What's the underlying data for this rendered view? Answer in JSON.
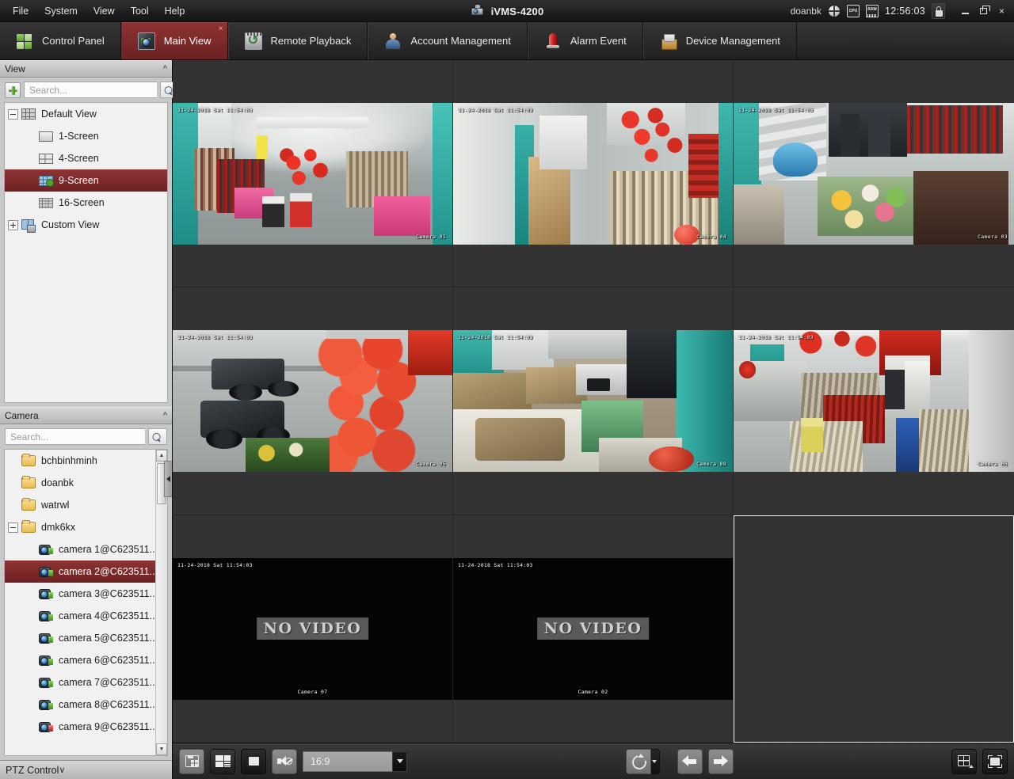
{
  "window": {
    "app_title": "iVMS-4200",
    "app_icon": "camera-logo-icon",
    "menu": [
      {
        "label": "File"
      },
      {
        "label": "System"
      },
      {
        "label": "View"
      },
      {
        "label": "Tool"
      },
      {
        "label": "Help"
      }
    ],
    "user": "doanbk",
    "status_icons": [
      "globe-icon",
      "cpu-icon",
      "ram-icon"
    ],
    "cpu_label": "CPU",
    "ram_label": "RAM",
    "clock": "12:56:03",
    "lock_icon": "lock-icon",
    "controls": {
      "minimize": "–",
      "restore": "restore",
      "close": "×"
    }
  },
  "tabs": [
    {
      "label": "Control Panel",
      "icon": "control-panel-icon",
      "active": false,
      "closable": false
    },
    {
      "label": "Main View",
      "icon": "main-view-icon",
      "active": true,
      "closable": true,
      "close_glyph": "×"
    },
    {
      "label": "Remote Playback",
      "icon": "remote-playback-icon",
      "active": false,
      "closable": false
    },
    {
      "label": "Account Management",
      "icon": "account-management-icon",
      "active": false,
      "closable": false
    },
    {
      "label": "Alarm Event",
      "icon": "alarm-event-icon",
      "active": false,
      "closable": false
    },
    {
      "label": "Device Management",
      "icon": "device-management-icon",
      "active": false,
      "closable": false
    }
  ],
  "sidebar": {
    "view_panel": {
      "title": "View",
      "collapse_glyph": "▲",
      "add_button": "add-view-button",
      "search_placeholder": "Search...",
      "search_value": "",
      "tree": [
        {
          "label": "Default View",
          "icon": "grid-view-icon",
          "level": 0,
          "expander": "minus",
          "selected": false
        },
        {
          "label": "1-Screen",
          "icon": "one-screen-icon",
          "level": 1,
          "expander": "none",
          "selected": false
        },
        {
          "label": "4-Screen",
          "icon": "four-screen-icon",
          "level": 1,
          "expander": "none",
          "selected": false
        },
        {
          "label": "9-Screen",
          "icon": "nine-screen-icon",
          "level": 1,
          "expander": "none",
          "selected": true
        },
        {
          "label": "16-Screen",
          "icon": "sixteen-screen-icon",
          "level": 1,
          "expander": "none",
          "selected": false
        },
        {
          "label": "Custom View",
          "icon": "custom-view-icon",
          "level": 0,
          "expander": "plus",
          "selected": false
        }
      ]
    },
    "camera_panel": {
      "title": "Camera",
      "collapse_glyph": "▲",
      "search_placeholder": "Search...",
      "search_value": "",
      "tree": [
        {
          "label": "bchbinhminh",
          "icon": "folder-icon",
          "level": 0,
          "expander": "none",
          "selected": false
        },
        {
          "label": "doanbk",
          "icon": "folder-icon",
          "level": 0,
          "expander": "none",
          "selected": false
        },
        {
          "label": "watrwl",
          "icon": "folder-icon",
          "level": 0,
          "expander": "none",
          "selected": false
        },
        {
          "label": "dmk6kx",
          "icon": "folder-icon",
          "level": 0,
          "expander": "minus",
          "selected": false
        },
        {
          "label": "camera 1@C623511...",
          "icon": "camera-online-icon",
          "level": 1,
          "expander": "none",
          "selected": false
        },
        {
          "label": "camera 2@C623511...",
          "icon": "camera-online-icon",
          "level": 1,
          "expander": "none",
          "selected": true
        },
        {
          "label": "camera 3@C623511...",
          "icon": "camera-online-icon",
          "level": 1,
          "expander": "none",
          "selected": false
        },
        {
          "label": "camera 4@C623511...",
          "icon": "camera-online-icon",
          "level": 1,
          "expander": "none",
          "selected": false
        },
        {
          "label": "camera 5@C623511...",
          "icon": "camera-online-icon",
          "level": 1,
          "expander": "none",
          "selected": false
        },
        {
          "label": "camera 6@C623511...",
          "icon": "camera-online-icon",
          "level": 1,
          "expander": "none",
          "selected": false
        },
        {
          "label": "camera 7@C623511...",
          "icon": "camera-online-icon",
          "level": 1,
          "expander": "none",
          "selected": false
        },
        {
          "label": "camera 8@C623511...",
          "icon": "camera-online-icon",
          "level": 1,
          "expander": "none",
          "selected": false
        },
        {
          "label": "camera 9@C623511...",
          "icon": "camera-offline-icon",
          "level": 1,
          "expander": "none",
          "selected": false
        }
      ]
    },
    "ptz_panel": {
      "title": "PTZ Control",
      "collapse_glyph": "▼"
    },
    "collapse_handle": "sidebar-collapse-arrow"
  },
  "video_grid": {
    "layout": "3x3",
    "panes": [
      {
        "index": 1,
        "state": "live",
        "osd_time": "11-24-2018 Sat 11:54:03",
        "camera_label": "Camera 01",
        "scene": "clothing-store-wide"
      },
      {
        "index": 2,
        "state": "live",
        "osd_time": "11-24-2018 Sat 11:54:03",
        "camera_label": "Camera 04",
        "scene": "store-aisle-balloons"
      },
      {
        "index": 3,
        "state": "live",
        "osd_time": "11-24-2018 Sat 11:54:03",
        "camera_label": "Camera 03",
        "scene": "stairwell-flowers"
      },
      {
        "index": 4,
        "state": "live",
        "osd_time": "11-24-2018 Sat 11:54:03",
        "camera_label": "Camera 05",
        "scene": "street-motorbikes"
      },
      {
        "index": 5,
        "state": "live",
        "osd_time": "11-24-2018 Sat 11:54:03",
        "camera_label": "Camera 08",
        "scene": "storage-room"
      },
      {
        "index": 6,
        "state": "live",
        "osd_time": "11-24-2018 Sat 11:54:03",
        "camera_label": "Camera 06",
        "scene": "store-racks-red"
      },
      {
        "index": 7,
        "state": "no-video",
        "osd_time": "11-24-2018 Sat 11:54:03",
        "camera_label": "Camera 07",
        "no_video_text": "NO VIDEO"
      },
      {
        "index": 8,
        "state": "no-video",
        "osd_time": "11-24-2018 Sat 11:54:03",
        "camera_label": "Camera 02",
        "no_video_text": "NO VIDEO"
      },
      {
        "index": 9,
        "state": "empty",
        "osd_time": "",
        "camera_label": "",
        "selected": true
      }
    ]
  },
  "toolbar": {
    "buttons_left": [
      {
        "name": "capture-button",
        "icon": "capture-icon"
      },
      {
        "name": "multi-window-button",
        "icon": "multi-window-icon"
      },
      {
        "name": "stop-all-button",
        "icon": "stop-icon"
      },
      {
        "name": "mute-button",
        "icon": "mute-speaker-icon"
      }
    ],
    "aspect_ratio": {
      "value": "16:9",
      "caret": "chevron-down-icon"
    },
    "buttons_center": [
      {
        "name": "auto-switch-button",
        "icon": "refresh-icon"
      },
      {
        "name": "auto-switch-dropdown",
        "icon": "chevron-down-icon"
      },
      {
        "name": "previous-page-button",
        "icon": "arrow-left-icon"
      },
      {
        "name": "next-page-button",
        "icon": "arrow-right-icon"
      }
    ],
    "buttons_right": [
      {
        "name": "window-division-button",
        "icon": "layout-grid-icon"
      },
      {
        "name": "full-screen-button",
        "icon": "fullscreen-icon"
      }
    ]
  },
  "colors": {
    "accent_red": "#7e2a2b",
    "selection_red": "#8e3334",
    "chrome_dark": "#2b2b2b",
    "sidebar_gray": "#c8c8c8",
    "pane_bg": "#333333",
    "selected_border": "#ffffff"
  }
}
